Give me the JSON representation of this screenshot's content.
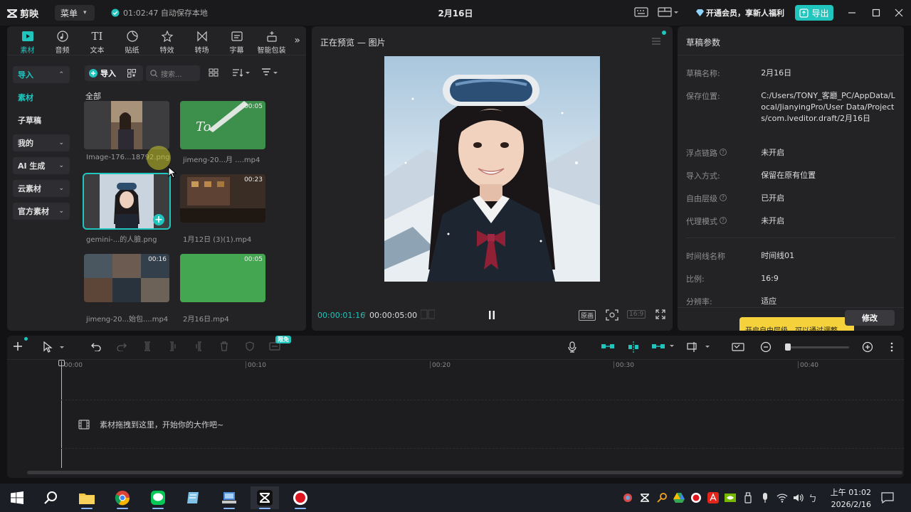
{
  "app": {
    "logo_text": "剪映",
    "menu_label": "菜单",
    "autosave_text": "01:02:47 自动保存本地",
    "window_title": "2月16日",
    "vip_text": "开通会员，享新人福利",
    "export_label": "导出"
  },
  "media": {
    "tabs": [
      {
        "label": "素材",
        "icon": "media-icon"
      },
      {
        "label": "音频",
        "icon": "audio-icon"
      },
      {
        "label": "文本",
        "icon": "text-icon"
      },
      {
        "label": "贴纸",
        "icon": "sticker-icon"
      },
      {
        "label": "特效",
        "icon": "effects-icon"
      },
      {
        "label": "转场",
        "icon": "transition-icon"
      },
      {
        "label": "字幕",
        "icon": "caption-icon"
      },
      {
        "label": "智能包装",
        "icon": "smart-package-icon"
      }
    ],
    "sidebar": [
      {
        "label": "导入"
      },
      {
        "label": "素材"
      },
      {
        "label": "子草稿"
      },
      {
        "label": "我的"
      },
      {
        "label": "AI 生成"
      },
      {
        "label": "云素材"
      },
      {
        "label": "官方素材"
      }
    ],
    "import_label": "导入",
    "search_placeholder": "搜索...",
    "all_label": "全部",
    "items": [
      {
        "name": "Image-176...18792.png",
        "duration": ""
      },
      {
        "name": "jimeng-20...月 ....mp4",
        "duration": "00:05"
      },
      {
        "name": "gemini-...的人臉.png",
        "duration": ""
      },
      {
        "name": "1月12日 (3)(1).mp4",
        "duration": "00:23"
      },
      {
        "name": "jimeng-20...始包....mp4",
        "duration": "00:16"
      },
      {
        "name": "2月16日.mp4",
        "duration": "00:05"
      }
    ]
  },
  "preview": {
    "title": "正在预览 — 图片",
    "current_time": "00:00:01:16",
    "separator": "/",
    "total_time": "00:00:05:00",
    "original_label": "原画",
    "ratio_label": "16:9"
  },
  "draft": {
    "title": "草稿参数",
    "rows": [
      {
        "label": "草稿名称:",
        "value": "2月16日",
        "help": false
      },
      {
        "label": "保存位置:",
        "value": "C:/Users/TONY_客廳_PC/AppData/Local/JianyingPro/User Data/Projects/com.lveditor.draft/2月16日",
        "help": false
      },
      {
        "label": "浮点链路",
        "value": "未开启",
        "help": true
      },
      {
        "label": "导入方式:",
        "value": "保留在原有位置",
        "help": false
      },
      {
        "label": "自由层级",
        "value": "已开启",
        "help": true
      },
      {
        "label": "代理模式",
        "value": "未开启",
        "help": true
      },
      {
        "label": "时间线名称",
        "value": "时间线01",
        "help": false
      },
      {
        "label": "比例:",
        "value": "16:9",
        "help": false
      },
      {
        "label": "分辨率:",
        "value": "适应",
        "help": false
      }
    ],
    "tip_text": "开启自由层级，可以通过调整",
    "modify_label": "修改"
  },
  "timeline": {
    "badge": "限免",
    "ruler": [
      "00:00",
      "00:10",
      "00:20",
      "00:30",
      "00:40"
    ],
    "hint": "素材拖拽到这里，开始你的大作吧~"
  },
  "taskbar": {
    "time": "上午 01:02",
    "date": "2026/2/16"
  },
  "colors": {
    "accent": "#20c5be",
    "panel": "#232326",
    "background": "#121214",
    "tip": "#f5d23c"
  }
}
